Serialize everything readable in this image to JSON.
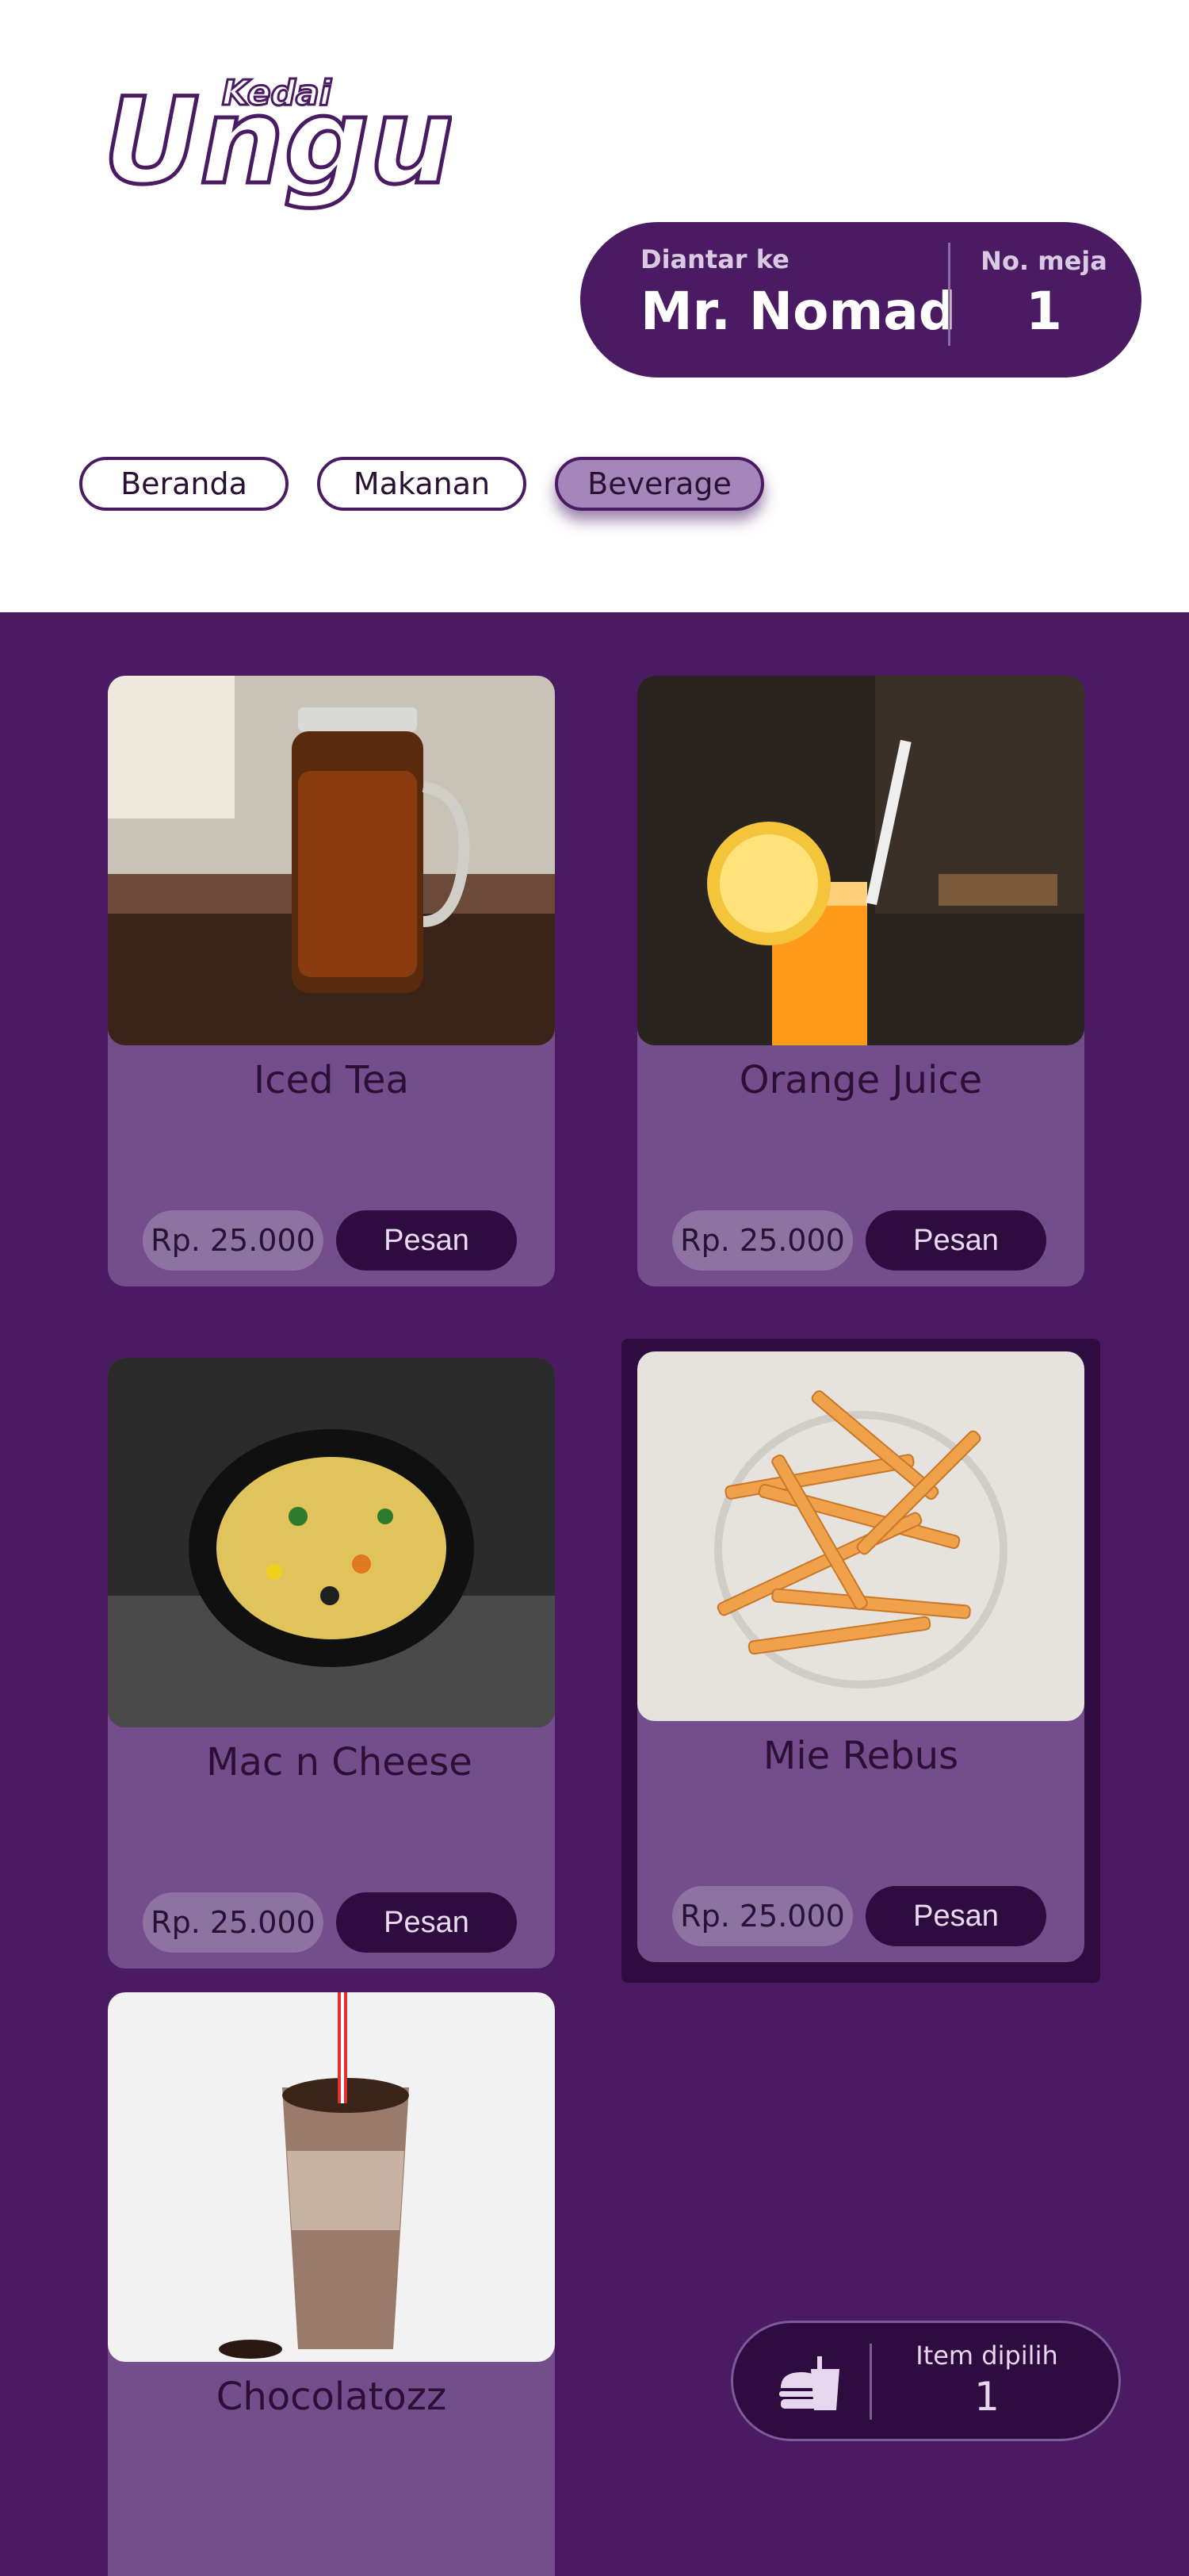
{
  "brand": {
    "logo_small": "Kedai",
    "logo_big": "Ungu"
  },
  "delivery": {
    "caption": "Diantar ke",
    "name": "Mr. Nomad",
    "table_caption": "No. meja",
    "table_number": "1"
  },
  "nav": {
    "tabs": [
      {
        "label": "Beranda"
      },
      {
        "label": "Makanan"
      },
      {
        "label": "Beverage",
        "active": true
      }
    ]
  },
  "menu": {
    "items": [
      {
        "name": "Iced Tea",
        "price": "Rp. 25.000",
        "button": "Pesan",
        "photo_icon": "iced-tea-photo"
      },
      {
        "name": "Orange Juice",
        "price": "Rp. 25.000",
        "button": "Pesan",
        "photo_icon": "orange-juice-photo"
      },
      {
        "name": "Mac n Cheese",
        "price": "Rp. 25.000",
        "button": "Pesan",
        "photo_icon": "mac-n-cheese-photo"
      },
      {
        "name": "Mie Rebus",
        "price": "Rp. 25.000",
        "button": "Pesan",
        "photo_icon": "fries-photo",
        "highlighted": true
      },
      {
        "name": "Chocolatozz",
        "price": "",
        "button": "",
        "photo_icon": "chocolate-drink-photo"
      }
    ]
  },
  "cart": {
    "caption": "Item dipilih",
    "count": "1",
    "icon": "burger-drink-icon"
  },
  "colors": {
    "primary": "#4a1b62",
    "card": "#744d8c",
    "dark": "#2e0c3f",
    "active_tab": "#a486bb"
  }
}
